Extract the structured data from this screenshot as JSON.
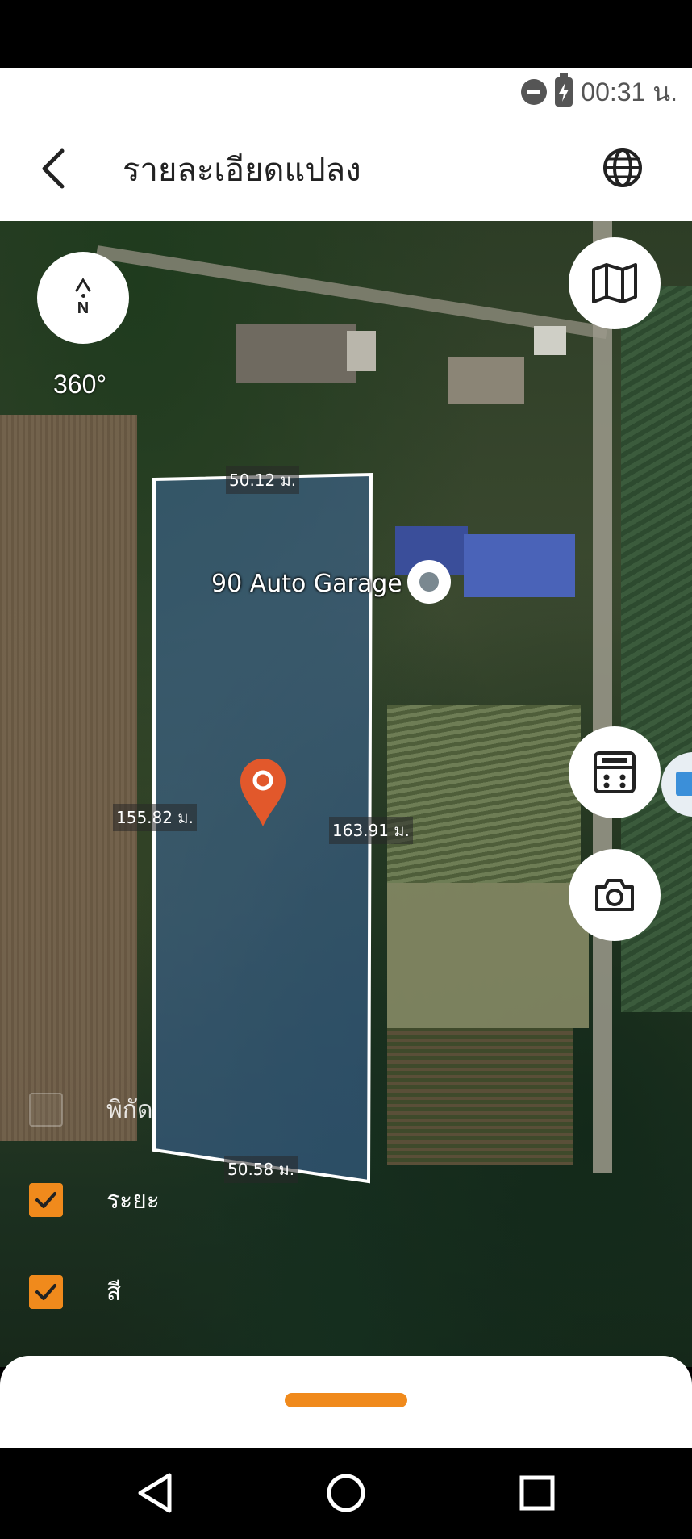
{
  "status_bar": {
    "time": "00:31 น."
  },
  "header": {
    "title": "รายละเอียดแปลง"
  },
  "map": {
    "compass_label": "N",
    "rotation_label": "360°",
    "place_label": "90 Auto Garage",
    "measurements": {
      "top": "50.12 ม.",
      "left": "155.82 ม.",
      "right": "163.91 ม.",
      "bottom": "50.58 ม."
    }
  },
  "layers": [
    {
      "label": "พิกัด",
      "checked": false
    },
    {
      "label": "ระยะ",
      "checked": true
    },
    {
      "label": "สี",
      "checked": true
    }
  ],
  "colors": {
    "accent": "#f08a1c",
    "pin": "#e2582b",
    "plot_fill": "#3f6aa0"
  },
  "icons": {
    "back": "chevron-left-icon",
    "language": "globe-icon",
    "map_type": "map-icon",
    "calculator": "calculator-icon",
    "camera": "camera-icon"
  }
}
